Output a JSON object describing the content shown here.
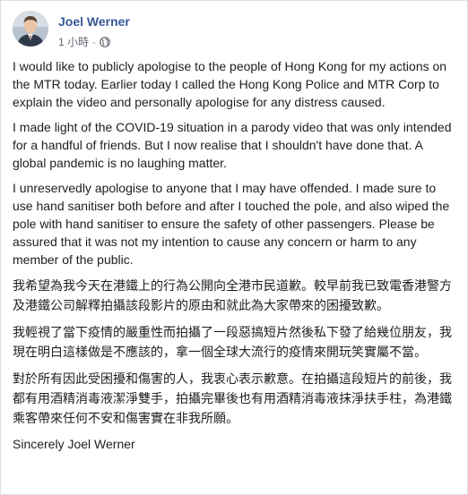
{
  "author": {
    "name": "Joel Werner"
  },
  "post_meta": {
    "time": "1 小時",
    "separator": "·",
    "audience_icon": "globe-icon"
  },
  "paragraphs": [
    "I would like to publicly apologise to the people of Hong Kong for my actions on the MTR today. Earlier today I called the Hong Kong Police and MTR Corp to explain the video and personally apologise for any distress caused.",
    "I made light of the COVID-19 situation in a parody video that was only intended for a handful of friends. But I now realise that I shouldn't have done that. A global pandemic is no laughing matter.",
    "I unreservedly apologise to anyone that I may have offended. I made sure to use hand sanitiser both before and after I touched the pole, and also wiped the pole with hand sanitiser to ensure the safety of other passengers. Please be assured that it was not my intention to cause any concern or harm to any member of the public.",
    "我希望為我今天在港鐵上的行為公開向全港市民道歉。較早前我已致電香港警方及港鐵公司解釋拍攝該段影片的原由和就此為大家帶來的困擾致歉。",
    "我輕視了當下疫情的嚴重性而拍攝了一段惡搞短片然後私下發了給幾位朋友，我現在明白這樣做是不應該的，拿一個全球大流行的疫情來開玩笑實屬不當。",
    "對於所有因此受困擾和傷害的人，我衷心表示歉意。在拍攝這段短片的前後，我都有用酒精消毒液潔淨雙手，拍攝完畢後也有用酒精消毒液抹淨扶手柱，為港鐵乘客帶來任何不安和傷害實在非我所願。",
    "Sincerely Joel Werner"
  ],
  "colors": {
    "author_link": "#385898",
    "meta_text": "#616770",
    "body_text": "#1c1e21"
  }
}
